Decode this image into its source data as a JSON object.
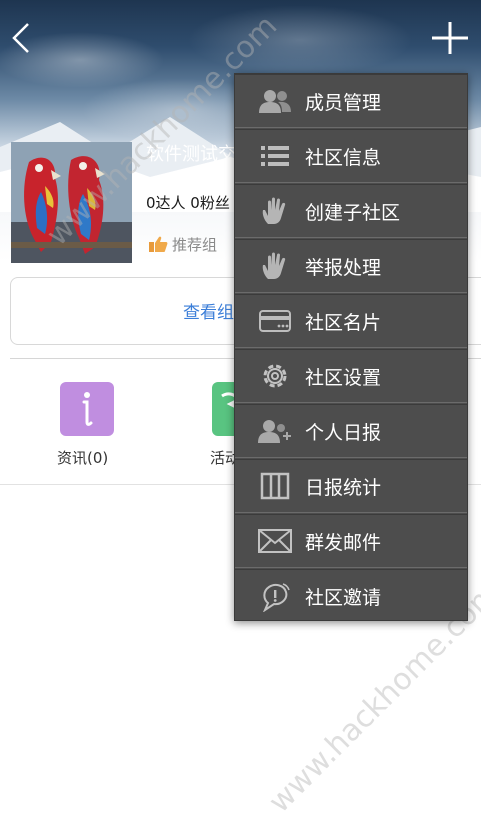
{
  "header": {
    "back_icon": "chevron-left-icon",
    "plus_icon": "plus-icon"
  },
  "community": {
    "name": "软件测试交",
    "stats": "0达人 0粉丝",
    "recommend": "推荐组"
  },
  "view_button": {
    "label": "查看组"
  },
  "tiles": [
    {
      "label": "资讯(0)",
      "icon": "info-icon",
      "color": "#c08ee0"
    },
    {
      "label": "活动",
      "icon": "activity-icon",
      "color": "#59c481"
    }
  ],
  "menu": {
    "items": [
      {
        "label": "成员管理",
        "icon": "members-icon"
      },
      {
        "label": "社区信息",
        "icon": "list-icon"
      },
      {
        "label": "创建子社区",
        "icon": "hand-icon"
      },
      {
        "label": "举报处理",
        "icon": "hand-icon"
      },
      {
        "label": "社区名片",
        "icon": "card-icon"
      },
      {
        "label": "社区设置",
        "icon": "gear-icon"
      },
      {
        "label": "个人日报",
        "icon": "person-report-icon"
      },
      {
        "label": "日报统计",
        "icon": "columns-icon"
      },
      {
        "label": "群发邮件",
        "icon": "mail-icon"
      },
      {
        "label": "社区邀请",
        "icon": "invite-icon"
      }
    ]
  },
  "watermark": "www.hackhome.com"
}
